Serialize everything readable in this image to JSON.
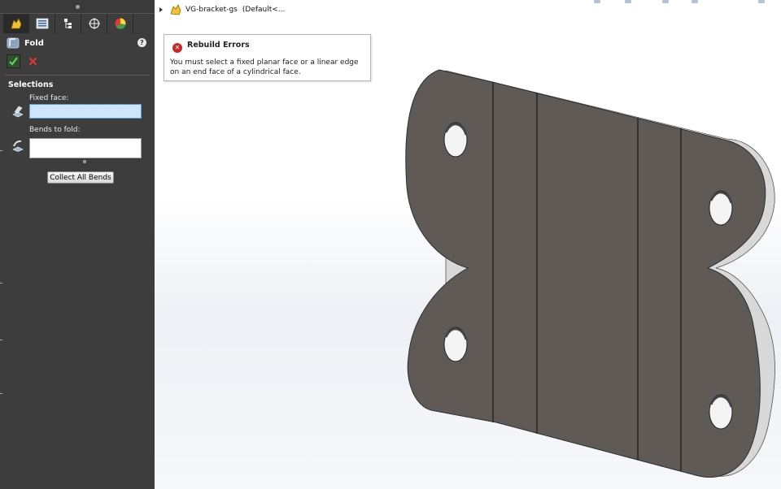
{
  "feature_manager": {
    "tabs": [
      {
        "name": "featuremanager-tab"
      },
      {
        "name": "propertymanager-tab"
      },
      {
        "name": "configurationmanager-tab"
      },
      {
        "name": "dimxpert-tab"
      },
      {
        "name": "display-manager-tab"
      }
    ],
    "feature_title": "Fold",
    "help_symbol": "?",
    "selections_group": "Selections",
    "fixed_face_label": "Fixed face:",
    "fixed_face_value": "",
    "bends_label": "Bends to fold:",
    "bends_value": "",
    "collect_button": "Collect All Bends"
  },
  "tree": {
    "part_name": "VG-bracket-gs",
    "configuration": "(Default<..."
  },
  "error_tooltip": {
    "title": "Rebuild Errors",
    "message": "You must select a fixed planar face or a linear edge on an end face of a cylindrical face."
  },
  "colors": {
    "panel_bg": "#3d3d3d",
    "part_face": "#5f5a55",
    "part_edge": "#d9d9d9",
    "error_red": "#c62828",
    "fixed_face_highlight": "#cfe5fb"
  },
  "icons": [
    "fold-feature-icon",
    "confirm-icon",
    "cancel-icon",
    "help-icon",
    "face-selection-icon",
    "bend-selection-icon",
    "part-icon",
    "expand-caret-icon",
    "error-icon"
  ]
}
